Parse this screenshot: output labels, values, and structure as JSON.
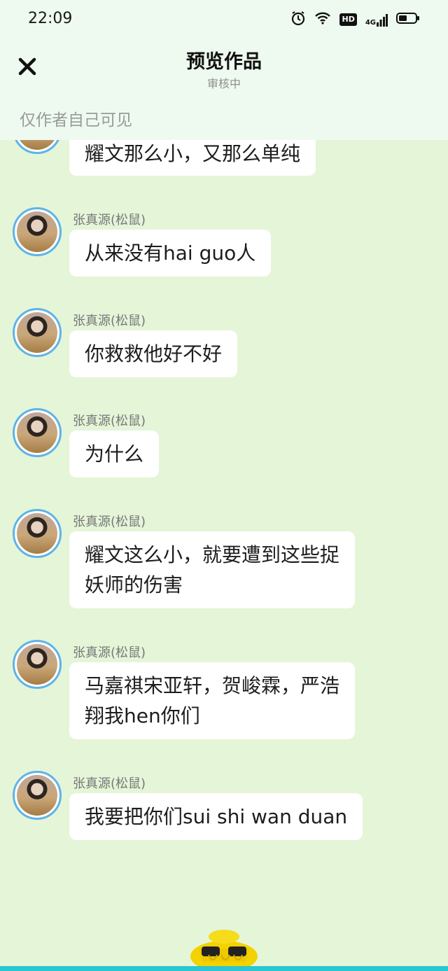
{
  "status": {
    "time": "22:09",
    "hd": "HD",
    "network": "4G"
  },
  "header": {
    "title": "预览作品",
    "subtitle": "审核中",
    "notice": "仅作者自己可见"
  },
  "messages": [
    {
      "sender": "",
      "text": "耀文那么小，又那么单纯"
    },
    {
      "sender": "张真源(松鼠)",
      "text": "从来没有hai guo人"
    },
    {
      "sender": "张真源(松鼠)",
      "text": "你救救他好不好"
    },
    {
      "sender": "张真源(松鼠)",
      "text": "为什么"
    },
    {
      "sender": "张真源(松鼠)",
      "text": "耀文这么小，就要遭到这些捉",
      "text2": "妖师的伤害"
    },
    {
      "sender": "张真源(松鼠)",
      "text": "马嘉祺宋亚轩，贺峻霖，严浩",
      "text2": "翔我hen你们"
    },
    {
      "sender": "张真源(松鼠)",
      "text": "我要把你们sui shi wan duan"
    }
  ],
  "colors": {
    "background": "#e5f5d8",
    "avatar_ring": "#5db4e9",
    "bottom_bar": "#29c6d4"
  }
}
